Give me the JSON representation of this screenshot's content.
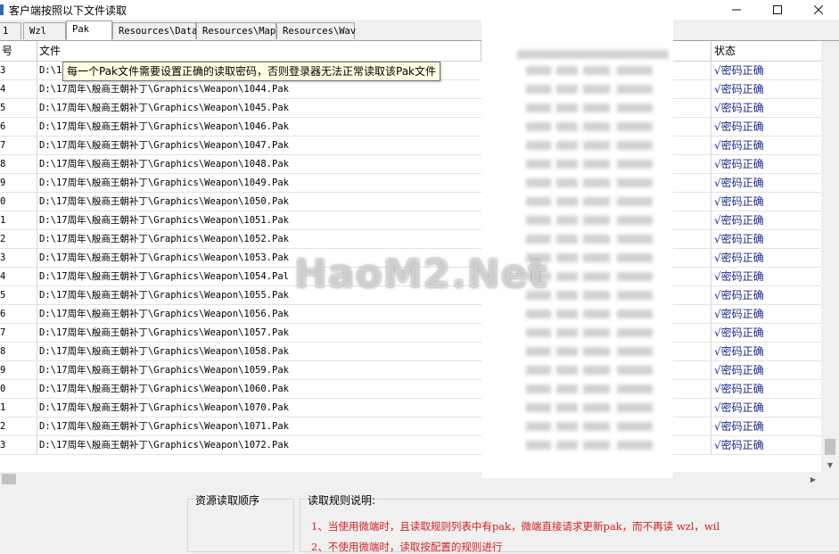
{
  "window": {
    "title": "客户端按照以下文件读取",
    "minimize": "—",
    "maximize": "☐",
    "close": "✕"
  },
  "tabs": [
    {
      "label": "1"
    },
    {
      "label": "Wzl"
    },
    {
      "label": "Pak"
    },
    {
      "label": "Resources\\Data"
    },
    {
      "label": "Resources\\Map"
    },
    {
      "label": "Resources\\Wav"
    }
  ],
  "grid": {
    "columns": {
      "num": "号",
      "file": "文件",
      "status": "状态"
    },
    "rows": [
      {
        "num": "3",
        "file": "D:\\17",
        "status": "√密码正确"
      },
      {
        "num": "4",
        "file": "D:\\17周年\\殷商王朝补丁\\Graphics\\Weapon\\1044.Pak",
        "status": "√密码正确"
      },
      {
        "num": "5",
        "file": "D:\\17周年\\殷商王朝补丁\\Graphics\\Weapon\\1045.Pak",
        "status": "√密码正确"
      },
      {
        "num": "6",
        "file": "D:\\17周年\\殷商王朝补丁\\Graphics\\Weapon\\1046.Pak",
        "status": "√密码正确"
      },
      {
        "num": "7",
        "file": "D:\\17周年\\殷商王朝补丁\\Graphics\\Weapon\\1047.Pak",
        "status": "√密码正确"
      },
      {
        "num": "8",
        "file": "D:\\17周年\\殷商王朝补丁\\Graphics\\Weapon\\1048.Pak",
        "status": "√密码正确"
      },
      {
        "num": "9",
        "file": "D:\\17周年\\殷商王朝补丁\\Graphics\\Weapon\\1049.Pak",
        "status": "√密码正确"
      },
      {
        "num": "0",
        "file": "D:\\17周年\\殷商王朝补丁\\Graphics\\Weapon\\1050.Pak",
        "status": "√密码正确"
      },
      {
        "num": "1",
        "file": "D:\\17周年\\殷商王朝补丁\\Graphics\\Weapon\\1051.Pak",
        "status": "√密码正确"
      },
      {
        "num": "2",
        "file": "D:\\17周年\\殷商王朝补丁\\Graphics\\Weapon\\1052.Pak",
        "status": "√密码正确"
      },
      {
        "num": "3",
        "file": "D:\\17周年\\殷商王朝补丁\\Graphics\\Weapon\\1053.Pak",
        "status": "√密码正确"
      },
      {
        "num": "4",
        "file": "D:\\17周年\\殷商王朝补丁\\Graphics\\Weapon\\1054.Pal",
        "status": "√密码正确"
      },
      {
        "num": "5",
        "file": "D:\\17周年\\殷商王朝补丁\\Graphics\\Weapon\\1055.Pak",
        "status": "√密码正确"
      },
      {
        "num": "6",
        "file": "D:\\17周年\\殷商王朝补丁\\Graphics\\Weapon\\1056.Pak",
        "status": "√密码正确"
      },
      {
        "num": "7",
        "file": "D:\\17周年\\殷商王朝补丁\\Graphics\\Weapon\\1057.Pak",
        "status": "√密码正确"
      },
      {
        "num": "8",
        "file": "D:\\17周年\\殷商王朝补丁\\Graphics\\Weapon\\1058.Pak",
        "status": "√密码正确"
      },
      {
        "num": "9",
        "file": "D:\\17周年\\殷商王朝补丁\\Graphics\\Weapon\\1059.Pak",
        "status": "√密码正确"
      },
      {
        "num": "0",
        "file": "D:\\17周年\\殷商王朝补丁\\Graphics\\Weapon\\1060.Pak",
        "status": "√密码正确"
      },
      {
        "num": "1",
        "file": "D:\\17周年\\殷商王朝补丁\\Graphics\\Weapon\\1070.Pak",
        "status": "√密码正确"
      },
      {
        "num": "2",
        "file": "D:\\17周年\\殷商王朝补丁\\Graphics\\Weapon\\1071.Pak",
        "status": "√密码正确"
      },
      {
        "num": "3",
        "file": "D:\\17周年\\殷商王朝补丁\\Graphics\\Weapon\\1072.Pak",
        "status": "√密码正确"
      }
    ]
  },
  "tooltip": {
    "text": "每一个Pak文件需要设置正确的读取密码，否则登录器无法正常读取该Pak文件"
  },
  "watermark": {
    "text": "HaoM2.Net"
  },
  "bottom": {
    "order_label": "资源读取顺序",
    "rules_label": "读取规则说明:",
    "rule_1": "1、当使用微端时，且读取规则列表中有pak，微端直接请求更新pak，而不再读 wzl，wil",
    "rule_2": "2、不使用微端时，读取按配置的规则进行"
  },
  "colors": {
    "status_text": "#1a2a8c",
    "rule_text": "#d42020",
    "tooltip_bg": "#ffffe1"
  }
}
